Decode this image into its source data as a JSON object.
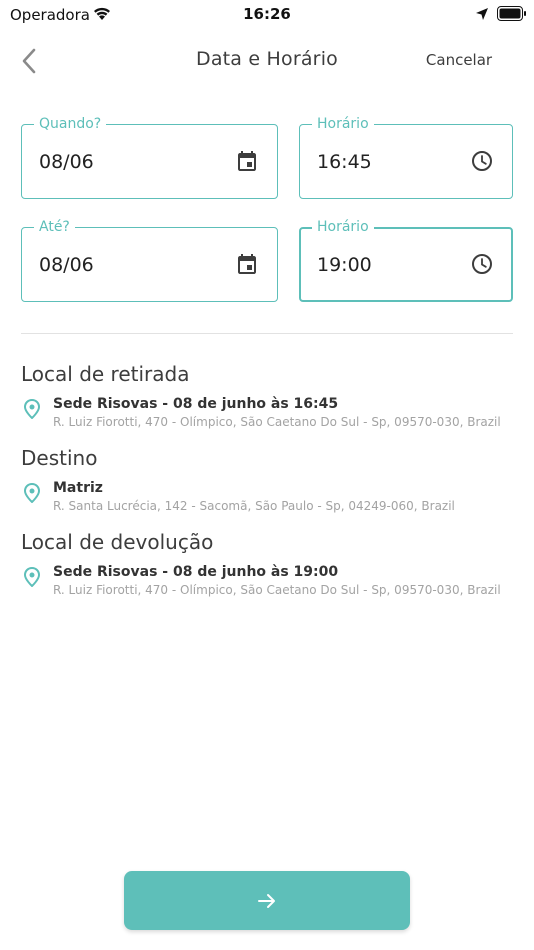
{
  "status_bar": {
    "carrier": "Operadora",
    "time": "16:26"
  },
  "nav": {
    "title": "Data e Horário",
    "cancel_label": "Cancelar"
  },
  "fields": {
    "start_date": {
      "label": "Quando?",
      "value": "08/06"
    },
    "start_time": {
      "label": "Horário",
      "value": "16:45"
    },
    "end_date": {
      "label": "Até?",
      "value": "08/06"
    },
    "end_time": {
      "label": "Horário",
      "value": "19:00"
    }
  },
  "sections": {
    "pickup": {
      "title": "Local de retirada",
      "name": "Sede Risovas - 08 de junho às 16:45",
      "address": "R. Luiz Fiorotti, 470 - Olímpico, São Caetano Do Sul - Sp, 09570-030, Brazil"
    },
    "destination": {
      "title": "Destino",
      "name": "Matriz",
      "address": "R. Santa Lucrécia, 142 - Sacomã, São Paulo - Sp, 04249-060, Brazil"
    },
    "return": {
      "title": "Local de devolução",
      "name": "Sede Risovas - 08 de junho às 19:00",
      "address": "R. Luiz Fiorotti, 470 - Olímpico, São Caetano Do Sul - Sp, 09570-030, Brazil"
    }
  },
  "colors": {
    "accent": "#5dbfb9",
    "text": "#333333",
    "muted": "#a3a3a3"
  },
  "icons": {
    "back": "chevron-left-icon",
    "calendar": "calendar-icon",
    "clock": "clock-icon",
    "pin": "location-pin-icon",
    "next": "arrow-right-icon"
  }
}
